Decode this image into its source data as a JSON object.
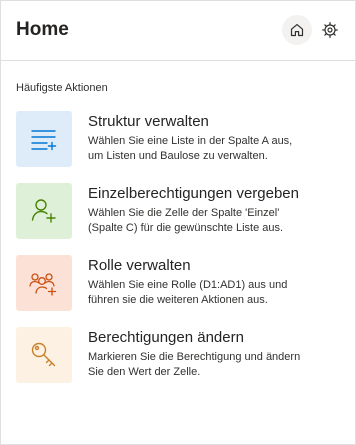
{
  "header": {
    "title": "Home"
  },
  "section": {
    "label": "Häufigste Aktionen"
  },
  "actions": [
    {
      "title": "Struktur verwalten",
      "desc_line1": "Wählen Sie eine Liste in der Spalte A aus,",
      "desc_line2": "um Listen und Baulose zu verwalten.",
      "icon": "list-add-icon",
      "tile_color": "#deecf9",
      "icon_color": "#0078d4"
    },
    {
      "title": "Einzelberechtigungen vergeben",
      "desc_line1": "Wählen Sie die Zelle der Spalte 'Einzel'",
      "desc_line2": "(Spalte C) für die gewünschte Liste aus.",
      "icon": "person-add-icon",
      "tile_color": "#dff0d8",
      "icon_color": "#498205"
    },
    {
      "title": "Rolle verwalten",
      "desc_line1": "Wählen Sie eine Rolle (D1:AD1) aus und",
      "desc_line2": "führen sie die weiteren Aktionen aus.",
      "icon": "people-add-icon",
      "tile_color": "#fbe1d6",
      "icon_color": "#ca5010"
    },
    {
      "title": "Berechtigungen ändern",
      "desc_line1": "Markieren Sie die Berechtigung und ändern",
      "desc_line2": "Sie den Wert der Zelle.",
      "icon": "key-icon",
      "tile_color": "#fdf1e3",
      "icon_color": "#c8812a"
    }
  ]
}
